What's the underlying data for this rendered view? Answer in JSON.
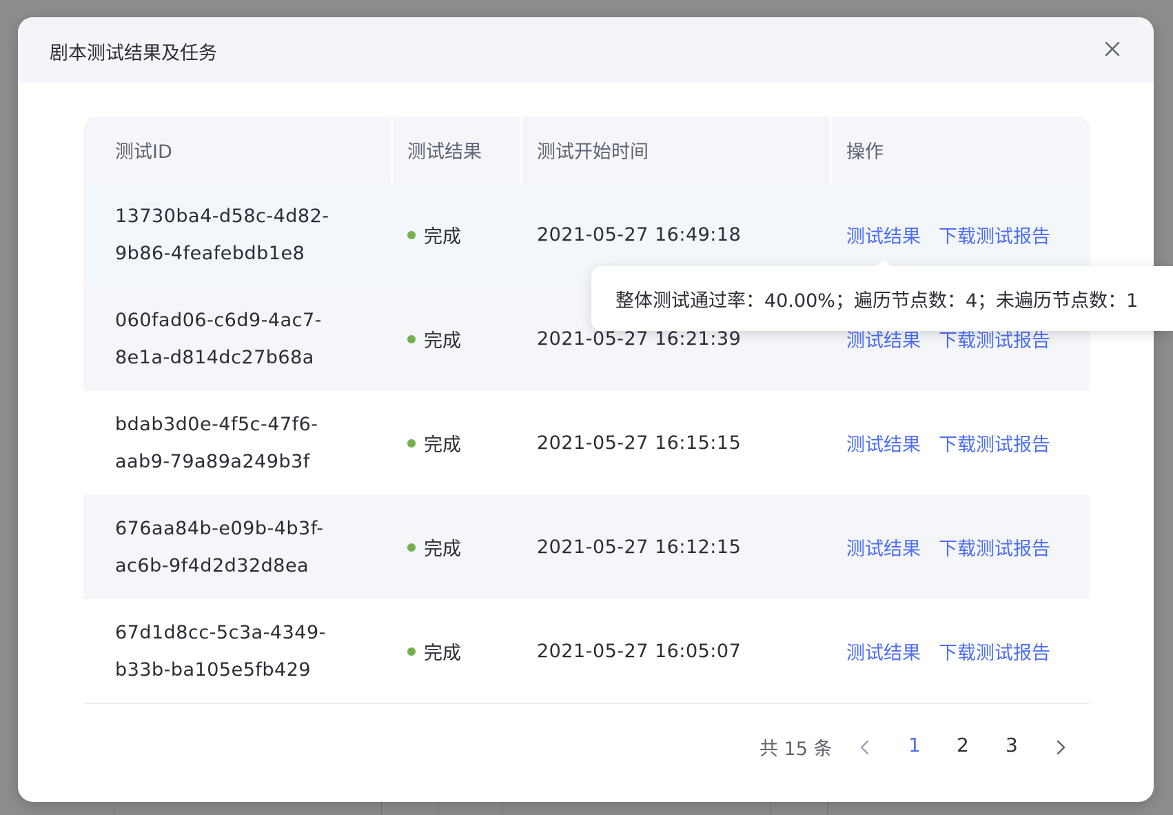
{
  "modal": {
    "title": "剧本测试结果及任务"
  },
  "table": {
    "headers": [
      "测试ID",
      "测试结果",
      "测试开始时间",
      "操作"
    ],
    "rows": [
      {
        "id_line1": "13730ba4-d58c-4d82-",
        "id_line2": "9b86-4feafebdb1e8",
        "status": "完成",
        "time": "2021-05-27 16:49:18",
        "action1": "测试结果",
        "action2": "下载测试报告"
      },
      {
        "id_line1": "060fad06-c6d9-4ac7-",
        "id_line2": "8e1a-d814dc27b68a",
        "status": "完成",
        "time": "2021-05-27 16:21:39",
        "action1": "测试结果",
        "action2": "下载测试报告"
      },
      {
        "id_line1": "bdab3d0e-4f5c-47f6-",
        "id_line2": "aab9-79a89a249b3f",
        "status": "完成",
        "time": "2021-05-27 16:15:15",
        "action1": "测试结果",
        "action2": "下载测试报告"
      },
      {
        "id_line1": "676aa84b-e09b-4b3f-",
        "id_line2": "ac6b-9f4d2d32d8ea",
        "status": "完成",
        "time": "2021-05-27 16:12:15",
        "action1": "测试结果",
        "action2": "下载测试报告"
      },
      {
        "id_line1": "67d1d8cc-5c3a-4349-",
        "id_line2": "b33b-ba105e5fb429",
        "status": "完成",
        "time": "2021-05-27 16:05:07",
        "action1": "测试结果",
        "action2": "下载测试报告"
      }
    ]
  },
  "tooltip": {
    "text": "整体测试通过率：40.00%；遍历节点数：4；未遍历节点数：1"
  },
  "pagination": {
    "total": "共 15 条",
    "pages": [
      "1",
      "2",
      "3"
    ],
    "current": "1"
  },
  "colors": {
    "accent": "#4c6ef5",
    "status_done": "#74b14d",
    "header_bg": "#f4f5f8"
  },
  "icons": {
    "close": "close-icon",
    "prev": "chevron-left-icon",
    "next": "chevron-right-icon"
  }
}
